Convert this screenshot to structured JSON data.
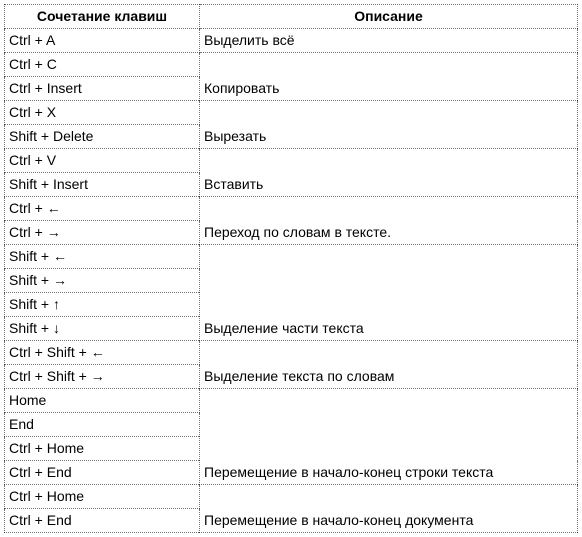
{
  "headers": {
    "shortcut": "Сочетание клавиш",
    "description": "Описание"
  },
  "rows": [
    {
      "key": "Ctrl + A",
      "desc": "Выделить всё",
      "span": 1
    },
    {
      "key": "Ctrl + C"
    },
    {
      "key": "Ctrl + Insert",
      "desc": "Копировать",
      "span": 2
    },
    {
      "key": "Ctrl + X"
    },
    {
      "key": "Shift + Delete",
      "desc": "Вырезать",
      "span": 2
    },
    {
      "key": "Ctrl + V"
    },
    {
      "key": "Shift + Insert",
      "desc": "Вставить",
      "span": 2
    },
    {
      "key": "Ctrl + ←"
    },
    {
      "key": "Ctrl + →",
      "desc": "Переход по словам в тексте.",
      "span": 2
    },
    {
      "key": "Shift + ←"
    },
    {
      "key": "Shift + →"
    },
    {
      "key": "Shift + ↑"
    },
    {
      "key": "Shift + ↓",
      "desc": "Выделение части текста",
      "span": 4
    },
    {
      "key": "Ctrl + Shift + ←"
    },
    {
      "key": "Ctrl + Shift + →",
      "desc": "Выделение текста по словам",
      "span": 2
    },
    {
      "key": "Home"
    },
    {
      "key": "End"
    },
    {
      "key": "Ctrl + Home"
    },
    {
      "key": "Ctrl + End",
      "desc": "Перемещение в начало-конец строки текста",
      "span": 4
    },
    {
      "key": "Ctrl + Home"
    },
    {
      "key": "Ctrl + End",
      "desc": "Перемещение в начало-конец документа",
      "span": 2
    }
  ]
}
